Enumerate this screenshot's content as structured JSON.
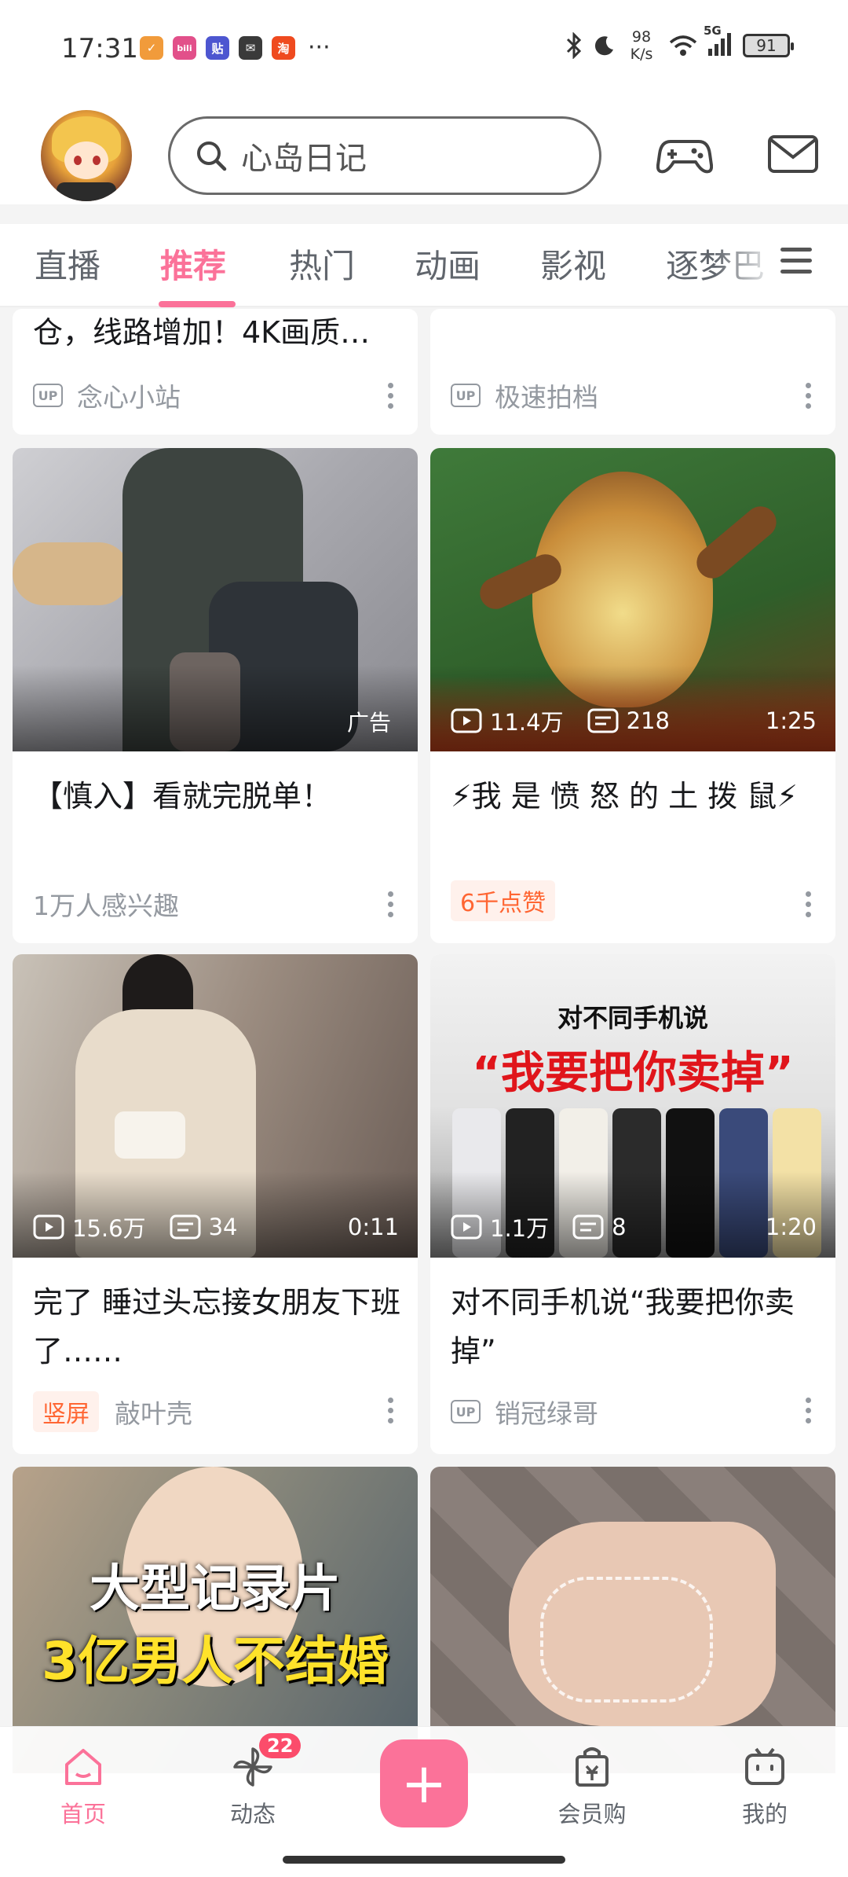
{
  "status_bar": {
    "time": "17:31",
    "apps": [
      {
        "icon": "app-shield-icon",
        "label": "✓",
        "color": "#f19b3b"
      },
      {
        "icon": "app-bilibili-icon",
        "label": "bili",
        "color": "#e2508a"
      },
      {
        "icon": "app-tieba-icon",
        "label": "贴",
        "color": "#4d56d0"
      },
      {
        "icon": "wechat-icon",
        "label": "✉",
        "color": "#3a3a3a"
      },
      {
        "icon": "app-taobao-icon",
        "label": "淘",
        "color": "#ef4a1f"
      }
    ],
    "more": "···",
    "net_speed_value": "98",
    "net_speed_unit": "K/s",
    "network": "5G",
    "battery": "91"
  },
  "header": {
    "search_text": "心岛日记"
  },
  "tabs": {
    "items": [
      "直播",
      "推荐",
      "热门",
      "动画",
      "影视",
      "逐梦巴"
    ],
    "active": "推荐"
  },
  "feed": {
    "top_left": {
      "title": "仓，线路增加！4K画质…",
      "author": "念心小站",
      "badge": "UP"
    },
    "top_right": {
      "author": "极速拍档",
      "badge": "UP"
    },
    "cards": [
      {
        "title": "【慎入】看就完脱单！",
        "ad": "广告",
        "meta": "1万人感兴趣"
      },
      {
        "title": "⚡我 是 愤 怒 的 土 拨 鼠⚡",
        "views": "11.4万",
        "comments": "218",
        "duration": "1:25",
        "pill": "6千点赞"
      },
      {
        "title": "完了 睡过头忘接女朋友下班了……",
        "views": "15.6万",
        "comments": "34",
        "duration": "0:11",
        "pill": "竖屏",
        "author": "敲叶壳"
      },
      {
        "title": "对不同手机说“我要把你卖掉”",
        "views": "1.1万",
        "comments": "8",
        "duration": "1:20",
        "author": "销冠绿哥",
        "badge": "UP",
        "thumb_title": "对不同手机说",
        "thumb_quote": "“我要把你卖掉”"
      },
      {
        "thumb_line1": "大型记录片",
        "thumb_line2": "3亿男人不结婚"
      },
      {}
    ]
  },
  "bottom_nav": {
    "items": [
      {
        "label": "首页",
        "icon": "home-icon"
      },
      {
        "label": "动态",
        "icon": "pinwheel-icon",
        "badge": "22"
      },
      {
        "label": "会员购",
        "icon": "shopping-bag-icon"
      },
      {
        "label": "我的",
        "icon": "tv-icon"
      }
    ],
    "fab": "+"
  },
  "colors": {
    "accent": "#fb7299",
    "text": "#18191c",
    "muted": "#9499a0",
    "pill_orange": "#ff6633"
  }
}
